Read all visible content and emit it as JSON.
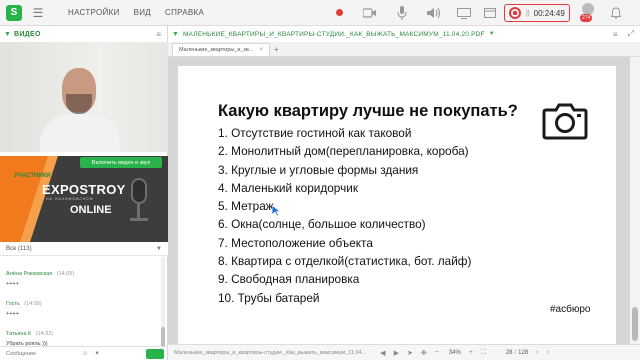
{
  "topbar": {
    "logo": "S",
    "menu": [
      "НАСТРОЙКИ",
      "ВИД",
      "СПРАВКА"
    ],
    "timer": "00:24:49",
    "timer_sep": "||",
    "badge_count": "274"
  },
  "video_panel": {
    "title": "ВИДЕО",
    "button_label": "Включить видео и звук"
  },
  "participants_panel": {
    "title": "УЧАСТНИКИ"
  },
  "promo": {
    "brand": "EXPOSTROY",
    "subtitle": "НА НАХИМОВСКОМ",
    "online": "ONLINE"
  },
  "chat": {
    "tab_label": "Все (113)",
    "messages": [
      {
        "name": "Алёна Рокковская",
        "time": "(14:09)",
        "text": "++++"
      },
      {
        "name": "Гость",
        "time": "(14:09)",
        "text": "++++"
      },
      {
        "name": "Татьяна К",
        "time": "(14:32)",
        "text": "Убрать рояль )))"
      }
    ],
    "input_placeholder": "Сообщение"
  },
  "document": {
    "title": "МАЛЕНЬКИЕ_КВАРТИРЫ_И_КВАРТИРЫ-СТУДИИ._КАК_ВЫЖАТЬ_МАКСИМУМ_11.04.20.PDF",
    "tab_label": "Маленькие_квартиры_и_кв...",
    "slide": {
      "title": "Какую квартиру лучше не покупать?",
      "items": [
        "1. Отсутствие гостиной как таковой",
        "2. Монолитный дом(перепланировка, короба)",
        "3. Круглые и угловые формы здания",
        "4. Маленький коридорчик",
        "5. Метраж",
        "6. Окна(солнце, большое количество)",
        "7. Местоположение объекта",
        "8. Квартира с отделкой(статистика, бот. лайф)",
        "9. Свободная планировка",
        "10. Трубы батарей"
      ],
      "hashtag": "#асбюро"
    },
    "footer": {
      "file_name": "Маленькие_квартиры_и_квартиры-студии._Как_выжать_максимум_11.04...",
      "zoom": "34%",
      "page": "28",
      "page_sep": "/",
      "total_pages": "128"
    }
  }
}
